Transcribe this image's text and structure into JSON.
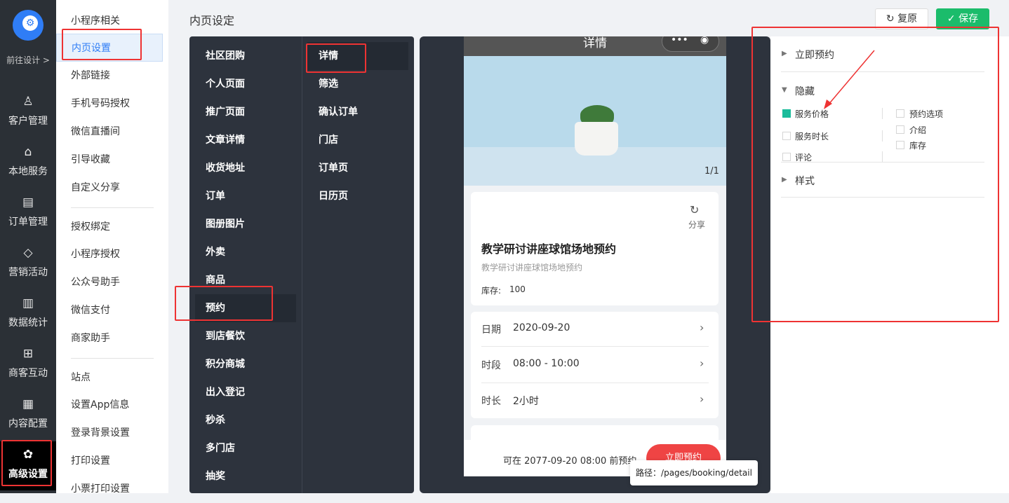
{
  "iconbar": {
    "goto_label": "前往设计 >",
    "items": [
      {
        "icon": "user-icon",
        "glyph": "♙",
        "label": "客户管理"
      },
      {
        "icon": "store-icon",
        "glyph": "⌂",
        "label": "本地服务"
      },
      {
        "icon": "clipboard-icon",
        "glyph": "▤",
        "label": "订单管理"
      },
      {
        "icon": "diamond-icon",
        "glyph": "◇",
        "label": "营销活动"
      },
      {
        "icon": "chart-icon",
        "glyph": "▥",
        "label": "数据统计"
      },
      {
        "icon": "grid-icon",
        "glyph": "⊞",
        "label": "商客互动"
      },
      {
        "icon": "document-icon",
        "glyph": "▦",
        "label": "内容配置"
      },
      {
        "icon": "gear-icon",
        "glyph": "✿",
        "label": "高级设置"
      }
    ]
  },
  "submenu": {
    "items": [
      "小程序相关",
      "内页设置",
      "外部链接",
      "手机号码授权",
      "微信直播间",
      "引导收藏",
      "自定义分享",
      "授权绑定",
      "小程序授权",
      "公众号助手",
      "微信支付",
      "商家助手",
      "站点",
      "设置App信息",
      "登录背景设置",
      "打印设置",
      "小票打印设置"
    ]
  },
  "header": {
    "title": "内页设定",
    "restore_label": "复原",
    "restore_icon": "↻",
    "save_label": "保存",
    "save_icon": "✓"
  },
  "categories": {
    "primary": [
      "社区团购",
      "个人页面",
      "推广页面",
      "文章详情",
      "收货地址",
      "订单",
      "图册图片",
      "外卖",
      "商品",
      "预约",
      "到店餐饮",
      "积分商城",
      "出入登记",
      "秒杀",
      "多门店",
      "抽奖"
    ],
    "secondary": [
      "详情",
      "筛选",
      "确认订单",
      "门店",
      "订单页",
      "日历页"
    ]
  },
  "preview": {
    "header_title": "详情",
    "menu_glyph": "•••",
    "target_glyph": "◉",
    "image_counter": "1/1",
    "share_glyph": "↻",
    "share_label": "分享",
    "product_title": "教学研讨讲座球馆场地预约",
    "product_subtitle": "教学研讨讲座球馆场地预约",
    "stock_label": "库存:",
    "stock_value": "100",
    "rows": [
      {
        "label": "日期",
        "value": "2020-09-20",
        "arrow": "›"
      },
      {
        "label": "时段",
        "value": "08:00 - 10:00",
        "arrow": "›"
      },
      {
        "label": "时长",
        "value": "2小时",
        "arrow": "›"
      }
    ],
    "footer_text": "可在 2077-09-20 08:00 前预约",
    "book_button": "立即预约",
    "path_tip": "路径：/pages/booking/detail"
  },
  "settings": {
    "section1": "立即预约",
    "section2": "隐藏",
    "section3": "样式",
    "collapsed_glyph": "▶",
    "expanded_glyph": "▼",
    "options": [
      {
        "label": "服务价格",
        "checked": true
      },
      {
        "label": "服务时长",
        "checked": false
      },
      {
        "label": "评论",
        "checked": false
      },
      {
        "label": "预约选项",
        "checked": false
      },
      {
        "label": "介绍",
        "checked": false
      },
      {
        "label": "库存",
        "checked": false
      }
    ]
  },
  "colors": {
    "accent": "#2f7df6",
    "save_green": "#1bbc6b",
    "highlight_red": "#e33333",
    "book_red": "#ef4444"
  }
}
